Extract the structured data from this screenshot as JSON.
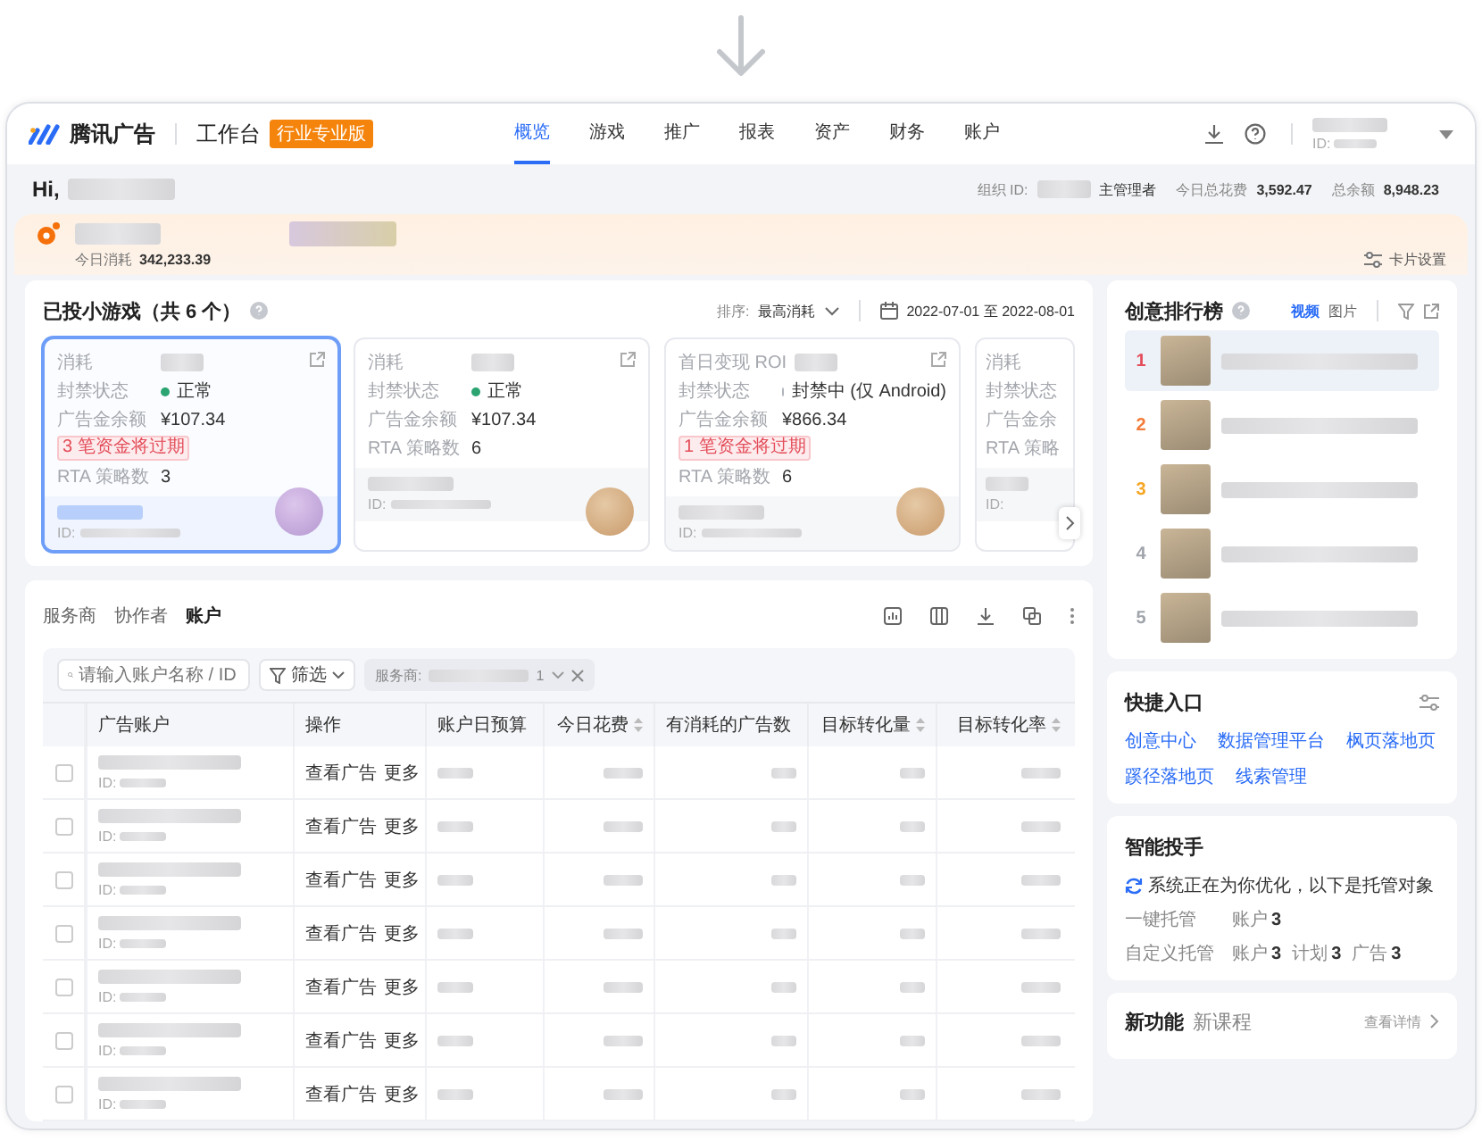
{
  "header": {
    "logo_text": "腾讯广告",
    "workspace": "工作台",
    "edition_badge": "行业专业版",
    "nav": [
      {
        "label": "概览",
        "selected": true
      },
      {
        "label": "游戏",
        "selected": false
      },
      {
        "label": "推广",
        "selected": false
      },
      {
        "label": "报表",
        "selected": false
      },
      {
        "label": "资产",
        "selected": false
      },
      {
        "label": "财务",
        "selected": false
      },
      {
        "label": "账户",
        "selected": false
      }
    ],
    "account": {
      "id_label": "ID:"
    }
  },
  "greeting": {
    "hello": "Hi,",
    "org_id_label": "组织 ID:",
    "role": "主管理者",
    "today_spend_label": "今日总花费",
    "today_spend": "3,592.47",
    "balance_label": "总余额",
    "balance": "8,948.23"
  },
  "game_tab": {
    "today_label": "今日消耗",
    "today_value": "342,233.39",
    "card_settings": "卡片设置"
  },
  "games": {
    "title": "已投小游戏（共 6 个）",
    "sort_label": "排序:",
    "sort_value": "最高消耗",
    "date_range": "2022-07-01 至 2022-08-01",
    "cards": [
      {
        "kind": "full",
        "selected": true,
        "metric_label": "消耗",
        "status_label": "封禁状态",
        "status": {
          "text": "正常",
          "color": "#2ba471"
        },
        "balance_label": "广告金余额",
        "balance": "¥107.34",
        "expiry_tag": "3 笔资金将过期",
        "rta_label": "RTA 策略数",
        "rta": "3",
        "id_label": "ID:"
      },
      {
        "kind": "full",
        "selected": false,
        "metric_label": "消耗",
        "status_label": "封禁状态",
        "status": {
          "text": "正常",
          "color": "#2ba471"
        },
        "balance_label": "广告金余额",
        "balance": "¥107.34",
        "rta_label": "RTA 策略数",
        "rta": "6",
        "id_label": "ID:"
      },
      {
        "kind": "full",
        "selected": false,
        "metric_label": "首日变现 ROI",
        "status_label": "封禁状态",
        "status": {
          "text": "封禁中 (仅 Android)",
          "color": "#b0b3ba"
        },
        "balance_label": "广告金余额",
        "balance": "¥866.34",
        "expiry_tag": "1 笔资金将过期",
        "rta_label": "RTA 策略数",
        "rta": "6",
        "id_label": "ID:"
      },
      {
        "kind": "partial",
        "metric_label": "消耗",
        "status_label": "封禁状态",
        "balance_label": "广告金余",
        "rta_label": "RTA 策略",
        "id_label": "ID:"
      }
    ]
  },
  "accounts": {
    "tabs": [
      {
        "label": "服务商",
        "selected": false
      },
      {
        "label": "协作者",
        "selected": false
      },
      {
        "label": "账户",
        "selected": true
      }
    ],
    "search": {
      "placeholder": "请输入账户名称 / ID"
    },
    "filter": "筛选",
    "chip": {
      "label": "服务商:",
      "count": "1"
    },
    "columns": [
      "广告账户",
      "操作",
      "账户日预算",
      "今日花费",
      "有消耗的广告数",
      "目标转化量",
      "目标转化率"
    ],
    "rows": [
      {
        "checked": false,
        "id_label": "ID:",
        "action": "查看广告",
        "more": "更多"
      },
      {
        "checked": false,
        "id_label": "ID:",
        "action": "查看广告",
        "more": "更多"
      },
      {
        "checked": false,
        "id_label": "ID:",
        "action": "查看广告",
        "more": "更多"
      },
      {
        "checked": false,
        "id_label": "ID:",
        "action": "查看广告",
        "more": "更多"
      },
      {
        "checked": false,
        "id_label": "ID:",
        "action": "查看广告",
        "more": "更多"
      },
      {
        "checked": false,
        "id_label": "ID:",
        "action": "查看广告",
        "more": "更多"
      },
      {
        "checked": false,
        "id_label": "ID:",
        "action": "查看广告",
        "more": "更多"
      }
    ]
  },
  "ranking": {
    "title": "创意排行榜",
    "tabs": [
      {
        "label": "视频",
        "selected": true
      },
      {
        "label": "图片",
        "selected": false
      }
    ],
    "items": [
      {
        "rank": "1",
        "color": "#e34d59",
        "selected": true
      },
      {
        "rank": "2",
        "color": "#f27c3a",
        "selected": false
      },
      {
        "rank": "3",
        "color": "#f5a623",
        "selected": false
      },
      {
        "rank": "4",
        "color": "#a0a4ab",
        "selected": false
      },
      {
        "rank": "5",
        "color": "#a0a4ab",
        "selected": false
      }
    ]
  },
  "shortcuts": {
    "title": "快捷入口",
    "links": [
      "创意中心",
      "数据管理平台",
      "枫页落地页",
      "蹊径落地页",
      "线索管理"
    ]
  },
  "assistant": {
    "title": "智能投手",
    "status": "系统正在为你优化，以下是托管对象",
    "rows": [
      {
        "label": "一键托管",
        "items": [
          {
            "label": "账户",
            "value": "3"
          }
        ]
      },
      {
        "label": "自定义托管",
        "items": [
          {
            "label": "账户",
            "value": "3"
          },
          {
            "label": "计划",
            "value": "3"
          },
          {
            "label": "广告",
            "value": "3"
          }
        ]
      }
    ]
  },
  "news": {
    "tabs": [
      {
        "label": "新功能",
        "selected": true
      },
      {
        "label": "新课程",
        "selected": false
      }
    ],
    "link": "查看详情"
  }
}
